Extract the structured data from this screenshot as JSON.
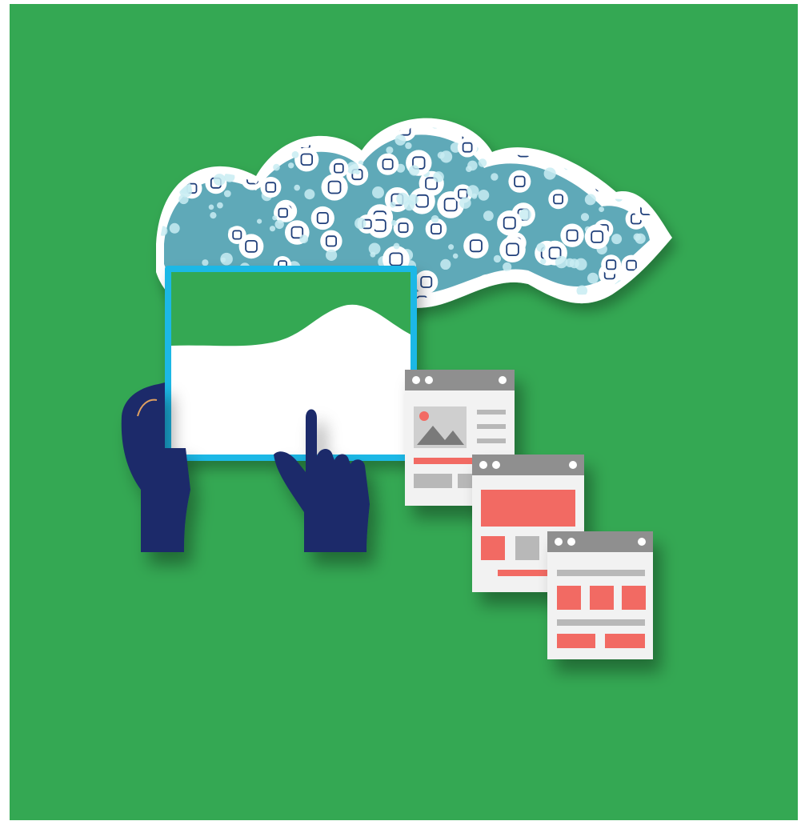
{
  "palette": {
    "frame_border": "#ffffff",
    "background": "#34a853",
    "cloud_white": "#ffffff",
    "cloud_fill": "#5fa9b8",
    "bubble": "#c8ecf2",
    "icon_ink": "#1f3f7a",
    "tablet_border": "#1bb8e6",
    "hand": "#1a2b6b",
    "window_bar": "#8f8f8f",
    "window_body": "#f2f2f2",
    "accent_red": "#f26b63",
    "gray_block": "#b8b8b8"
  },
  "icons": [
    "mail-icon",
    "chart-icon",
    "lock-icon",
    "clock-icon",
    "settings-icon",
    "camera-icon",
    "calendar-icon",
    "location-icon",
    "phone-icon",
    "search-icon",
    "play-icon",
    "cart-icon",
    "user-icon",
    "cloud-icon",
    "gift-icon",
    "music-icon",
    "folder-icon",
    "pointer-icon"
  ],
  "windows": [
    {
      "name": "image-page-window",
      "layout": "image-with-text"
    },
    {
      "name": "hero-page-window",
      "layout": "hero-block"
    },
    {
      "name": "grid-page-window",
      "layout": "grid-blocks"
    }
  ]
}
